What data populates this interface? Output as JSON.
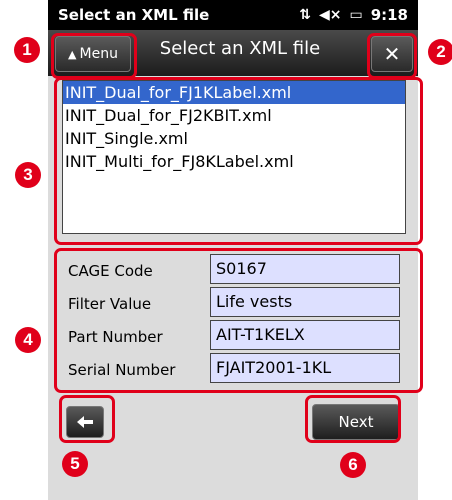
{
  "status_bar": {
    "title": "Select an XML file",
    "time": "9:18",
    "icons": [
      "connectivity-icon",
      "volume-mute-icon",
      "battery-charging-icon"
    ]
  },
  "title_bar": {
    "menu_label": "Menu",
    "title": "Select an XML file",
    "close_label": "✕"
  },
  "file_list": {
    "items": [
      {
        "label": "INIT_Dual_for_FJ1KLabel.xml",
        "selected": true
      },
      {
        "label": "INIT_Dual_for_FJ2KBIT.xml",
        "selected": false
      },
      {
        "label": "INIT_Single.xml",
        "selected": false
      },
      {
        "label": "INIT_Multi_for_FJ8KLabel.xml",
        "selected": false
      }
    ]
  },
  "fields": [
    {
      "label": "CAGE Code",
      "value": "S0167"
    },
    {
      "label": "Filter Value",
      "value": "Life vests"
    },
    {
      "label": "Part Number",
      "value": "AIT-T1KELX"
    },
    {
      "label": "Serial Number",
      "value": "FJAIT2001-1KL"
    }
  ],
  "footer": {
    "next_label": "Next"
  },
  "callouts": [
    "1",
    "2",
    "3",
    "4",
    "5",
    "6"
  ],
  "colors": {
    "callout": "#e0001a",
    "selection": "#3366cc",
    "field_bg": "#dde0ff"
  }
}
